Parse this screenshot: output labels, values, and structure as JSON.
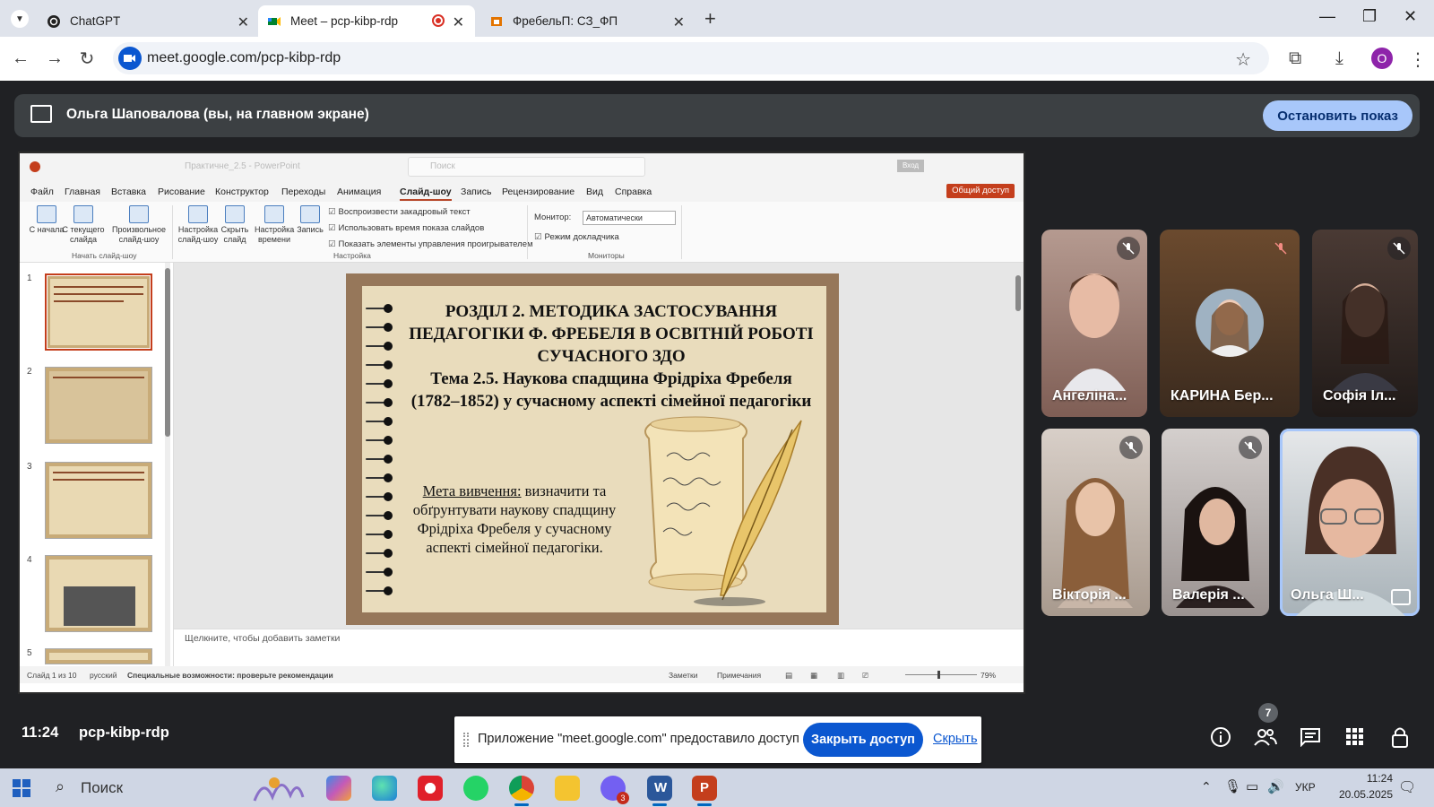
{
  "browser": {
    "tabs": [
      {
        "title": "ChatGPT",
        "active": false
      },
      {
        "title": "Meet – pcp-kibp-rdp",
        "active": true
      },
      {
        "title": "ФребельП: СЗ_ФП",
        "active": false
      }
    ],
    "url": "meet.google.com/pcp-kibp-rdp",
    "profile_initial": "О"
  },
  "meet": {
    "presenting_label": "Ольга Шаповалова (вы, на главном экране)",
    "stop_button": "Остановить показ",
    "clock": "11:24",
    "meeting_code": "pcp-kibp-rdp",
    "participants_count": "7",
    "participants": [
      {
        "name": "Ангеліна...",
        "muted": true
      },
      {
        "name": "КАРИНА Бер...",
        "muted": true
      },
      {
        "name": "Софія Іл...",
        "muted": true
      },
      {
        "name": "Вікторія ...",
        "muted": true
      },
      {
        "name": "Валерія ...",
        "muted": true
      },
      {
        "name": "Ольга Ш...",
        "muted": false
      }
    ],
    "share_banner": {
      "message": "Приложение \"meet.google.com\" предоставило доступ к окну.",
      "close_access": "Закрыть доступ",
      "hide": "Скрыть"
    }
  },
  "powerpoint": {
    "doc_title": "Практичне_2.5 - PowerPoint",
    "search_placeholder": "Поиск",
    "login": "Вход",
    "share": "Общий доступ",
    "menu": [
      "Файл",
      "Главная",
      "Вставка",
      "Рисование",
      "Конструктор",
      "Переходы",
      "Анимация",
      "Слайд-шоу",
      "Запись",
      "Рецензирование",
      "Вид",
      "Справка"
    ],
    "ribbon": {
      "from_start": "С начала",
      "from_current": "С текущего слайда",
      "custom_show": "Произвольное слайд-шоу",
      "group_start": "Начать слайд-шоу",
      "setup_show": "Настройка слайд-шоу",
      "hide_slide": "Скрыть слайд",
      "rehearse": "Настройка времени",
      "record": "Запись",
      "opt_narration": "Воспроизвести закадровый текст",
      "opt_timings": "Использовать время показа слайдов",
      "opt_controls": "Показать элементы управления проигрывателем",
      "group_setup": "Настройка",
      "monitor_label": "Монитор:",
      "monitor_value": "Автоматически",
      "presenter_view": "Режим докладчика",
      "group_monitors": "Мониторы"
    },
    "thumb_numbers": [
      "1",
      "2",
      "3",
      "4",
      "5"
    ],
    "slide": {
      "title": "РОЗДІЛ 2. МЕТОДИКА ЗАСТОСУВАННЯ ПЕДАГОГІКИ Ф. ФРЕБЕЛЯ В ОСВІТНІЙ РОБОТІ СУЧАСНОГО ЗДО",
      "topic": "Тема 2.5. Наукова спадщина Фрідріха Фребеля (1782–1852) у сучасному аспекті сімейної педагогіки",
      "goal_label": "Мета вивчення:",
      "goal_text": "визначити та обґрунтувати наукову спадщину Фрідріха Фребеля у сучасному аспекті сімейної педагогіки."
    },
    "notes_placeholder": "Щелкните, чтобы добавить заметки",
    "status": {
      "slide": "Слайд 1 из 10",
      "language": "русский",
      "accessibility": "Специальные возможности: проверьте рекомендации",
      "notes": "Заметки",
      "comments": "Примечания",
      "zoom": "79%"
    }
  },
  "taskbar": {
    "search": "Поиск",
    "lang": "УКР",
    "time": "11:24",
    "date": "20.05.2025",
    "viber_badge": "3"
  }
}
